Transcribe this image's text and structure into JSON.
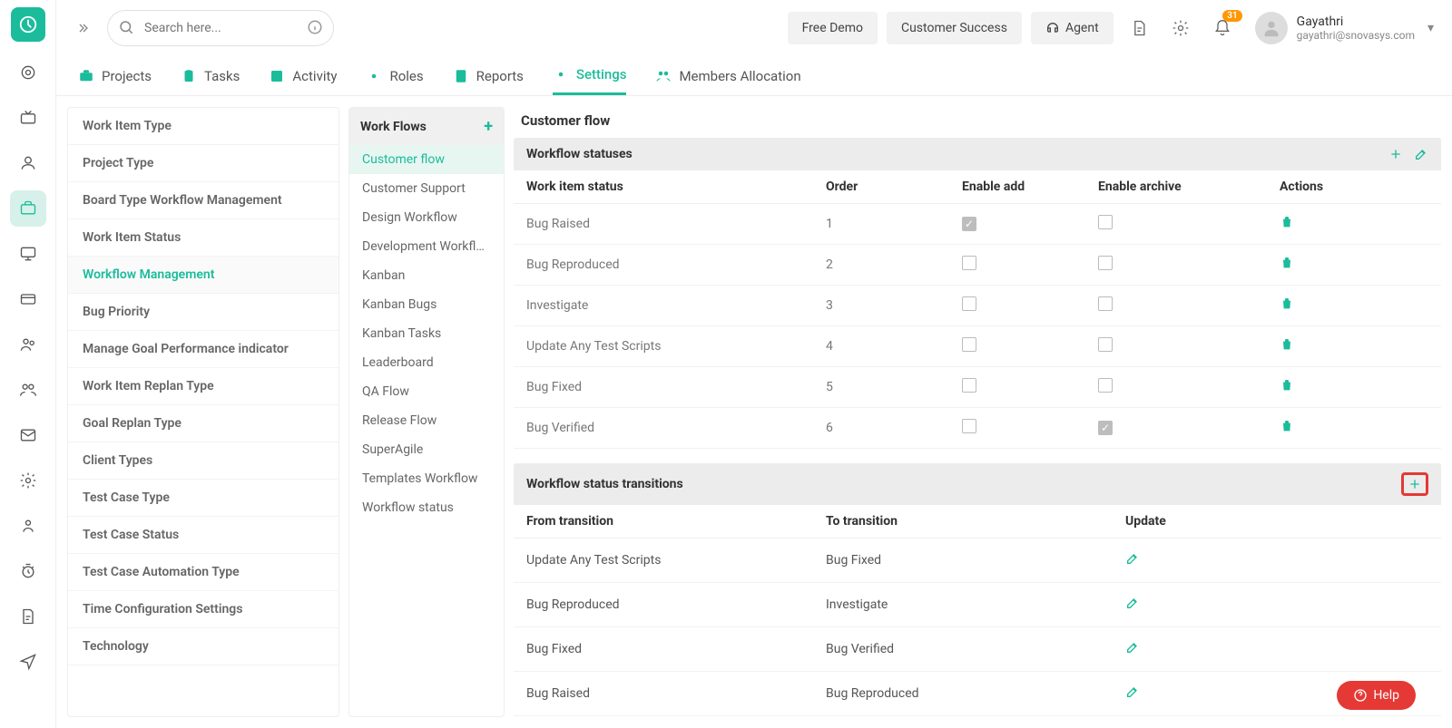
{
  "search": {
    "placeholder": "Search here..."
  },
  "topButtons": {
    "demo": "Free Demo",
    "success": "Customer Success",
    "agent": "Agent"
  },
  "notifications": {
    "count": "31"
  },
  "user": {
    "name": "Gayathri",
    "email": "gayathri@snovasys.com"
  },
  "tabs": [
    {
      "label": "Projects",
      "icon": "briefcase"
    },
    {
      "label": "Tasks",
      "icon": "clipboard"
    },
    {
      "label": "Activity",
      "icon": "activity"
    },
    {
      "label": "Roles",
      "icon": "gear"
    },
    {
      "label": "Reports",
      "icon": "report"
    },
    {
      "label": "Settings",
      "icon": "gear",
      "active": true
    },
    {
      "label": "Members Allocation",
      "icon": "people"
    }
  ],
  "settingsItems": [
    "Work Item Type",
    "Project Type",
    "Board Type Workflow Management",
    "Work Item Status",
    "Workflow Management",
    "Bug Priority",
    "Manage Goal Performance indicator",
    "Work Item Replan Type",
    "Goal Replan Type",
    "Client Types",
    "Test Case Type",
    "Test Case Status",
    "Test Case Automation Type",
    "Time Configuration Settings",
    "Technology"
  ],
  "settingsActiveIndex": 4,
  "workflows": {
    "title": "Work Flows",
    "items": [
      "Customer flow",
      "Customer Support",
      "Design Workflow",
      "Development Workflow",
      "Kanban",
      "Kanban Bugs",
      "Kanban Tasks",
      "Leaderboard",
      "QA Flow",
      "Release Flow",
      "SuperAgile",
      "Templates Workflow",
      "Workflow status"
    ],
    "activeIndex": 0
  },
  "detail": {
    "title": "Customer flow",
    "statusesHeader": "Workflow statuses",
    "columns": {
      "status": "Work item status",
      "order": "Order",
      "enableAdd": "Enable add",
      "enableArchive": "Enable archive",
      "actions": "Actions"
    },
    "statuses": [
      {
        "name": "Bug Raised",
        "order": "1",
        "add": true,
        "archive": false
      },
      {
        "name": "Bug Reproduced",
        "order": "2",
        "add": false,
        "archive": false
      },
      {
        "name": "Investigate",
        "order": "3",
        "add": false,
        "archive": false
      },
      {
        "name": "Update Any Test Scripts",
        "order": "4",
        "add": false,
        "archive": false
      },
      {
        "name": "Bug Fixed",
        "order": "5",
        "add": false,
        "archive": false
      },
      {
        "name": "Bug Verified",
        "order": "6",
        "add": false,
        "archive": true
      }
    ],
    "transitionsHeader": "Workflow status transitions",
    "transColumns": {
      "from": "From transition",
      "to": "To transition",
      "update": "Update"
    },
    "transitions": [
      {
        "from": "Update Any Test Scripts",
        "to": "Bug Fixed"
      },
      {
        "from": "Bug Reproduced",
        "to": "Investigate"
      },
      {
        "from": "Bug Fixed",
        "to": "Bug Verified"
      },
      {
        "from": "Bug Raised",
        "to": "Bug Reproduced"
      }
    ]
  },
  "help": "Help"
}
